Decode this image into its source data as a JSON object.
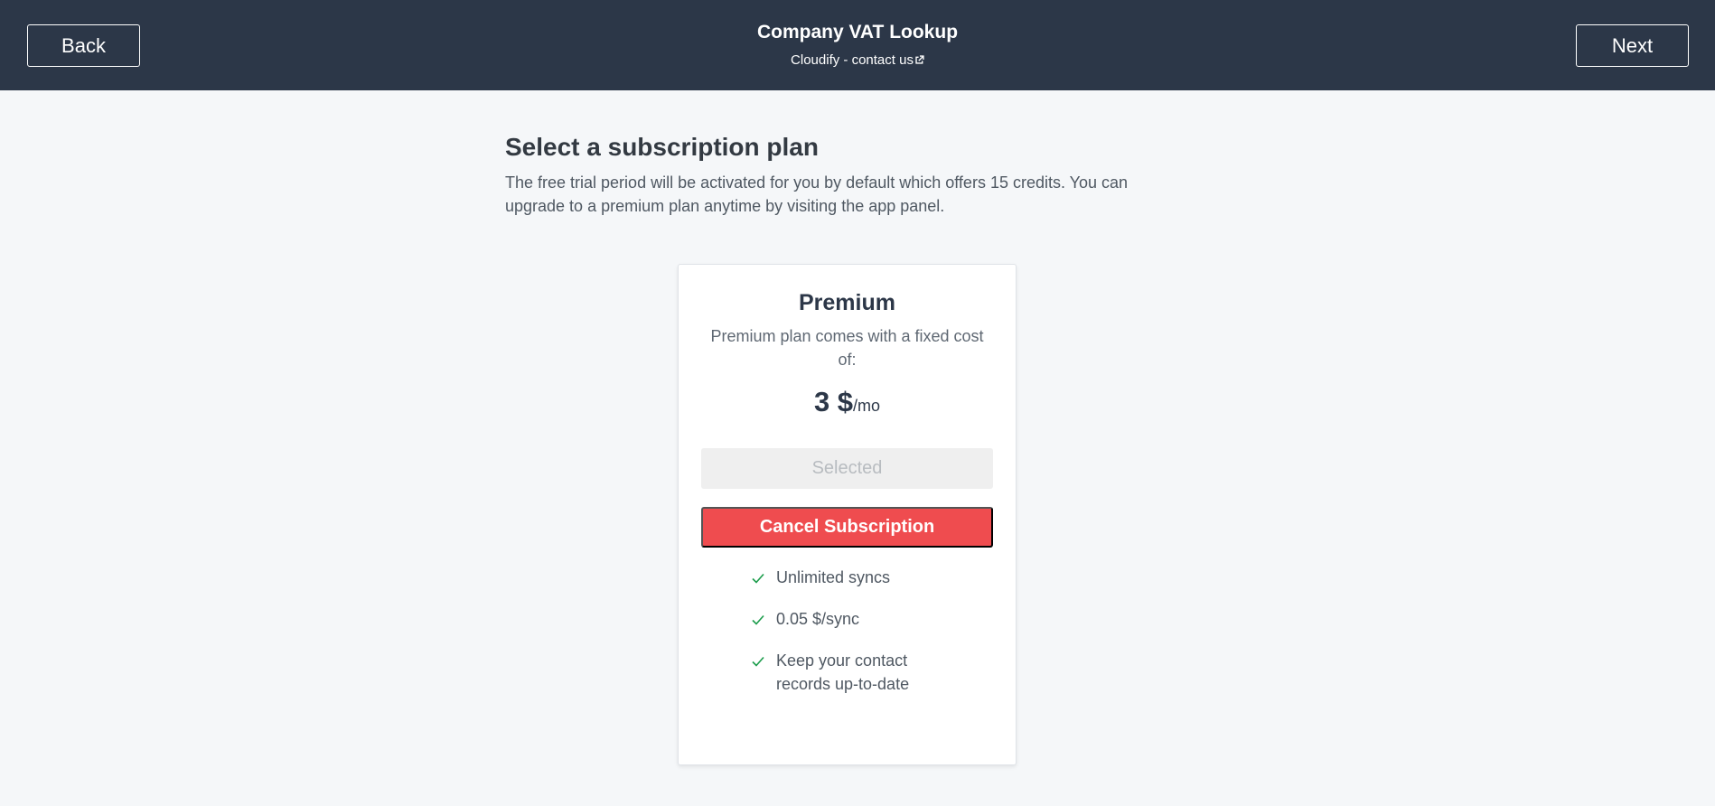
{
  "header": {
    "back_label": "Back",
    "next_label": "Next",
    "app_title": "Company VAT Lookup",
    "contact_link": "Cloudify - contact us"
  },
  "main": {
    "title": "Select a subscription plan",
    "description": "The free trial period will be activated for you by default which offers 15 credits. You can upgrade to a premium plan anytime by visiting the app panel."
  },
  "plan": {
    "name": "Premium",
    "description": "Premium plan comes with a fixed cost of:",
    "price_amount": "3 $",
    "price_unit": "/mo",
    "selected_label": "Selected",
    "cancel_label": "Cancel Subscription",
    "features": [
      "Unlimited syncs",
      "0.05 $/sync",
      "Keep your contact records up-to-date"
    ]
  },
  "colors": {
    "header_bg": "#2c3748",
    "page_bg": "#f5f7f9",
    "cancel_red": "#ef4c4f",
    "check_green": "#1a9c4a"
  },
  "icons": {
    "external_link": "external-link-icon",
    "feature_check": "check-icon"
  }
}
